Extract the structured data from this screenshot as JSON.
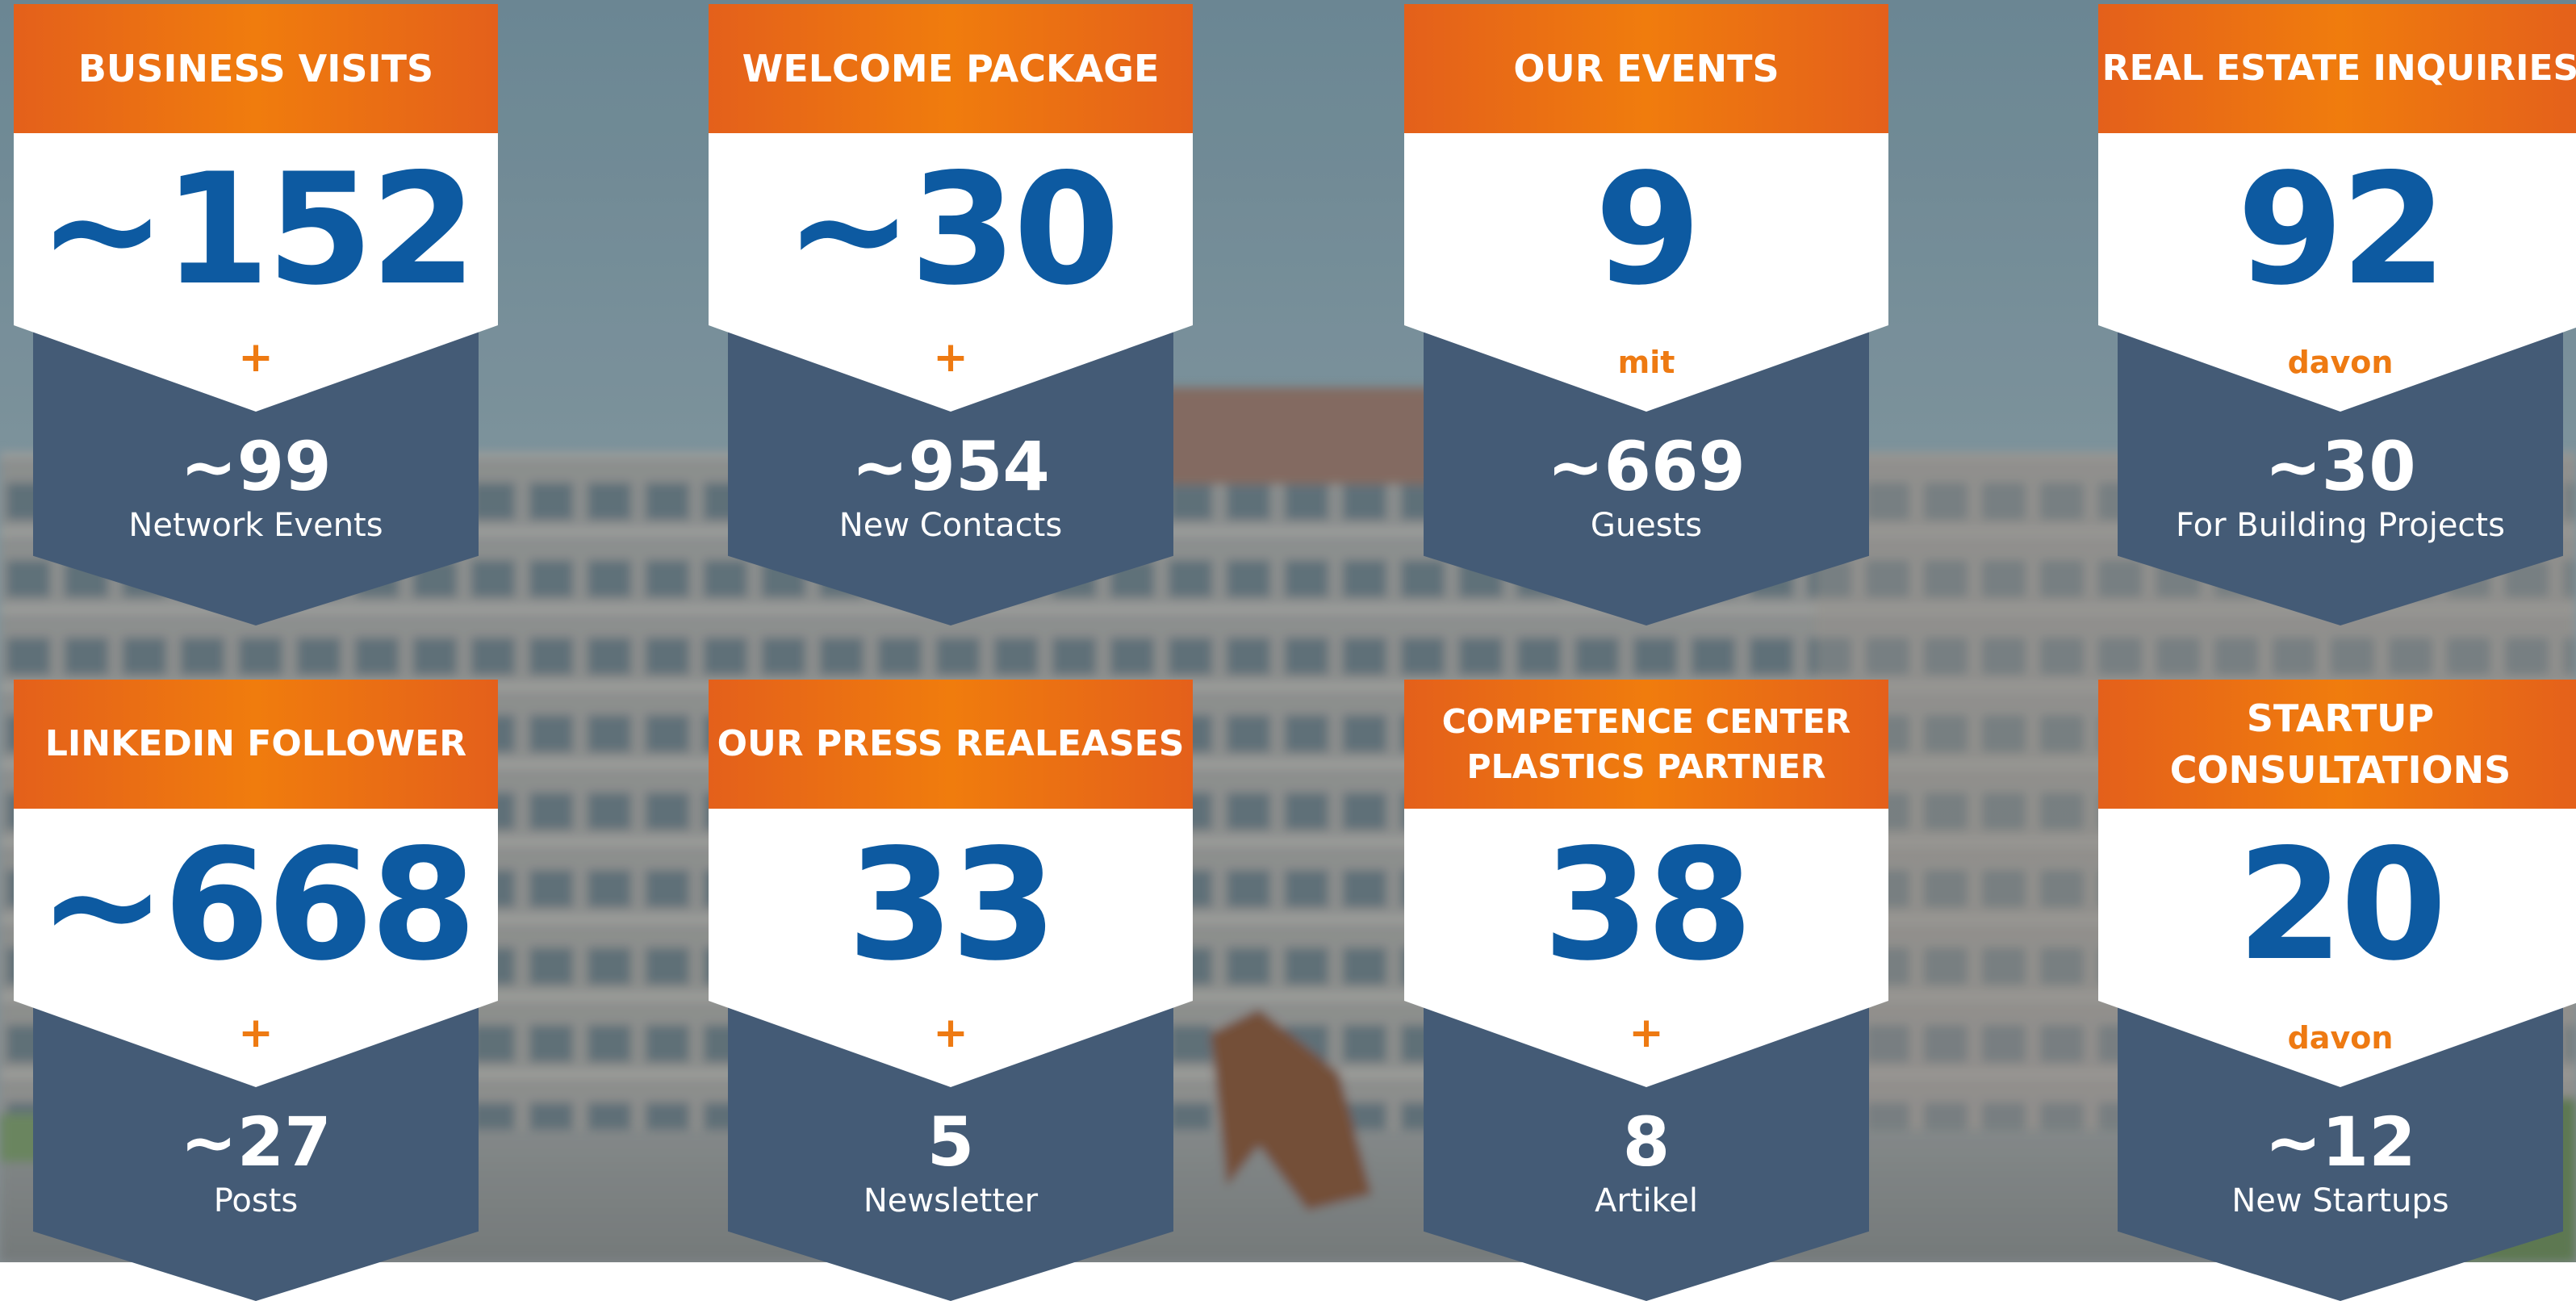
{
  "colors": {
    "header_orange": "#f07c0d",
    "number_blue": "#0d5aa1",
    "connector_orange": "#ee7a12",
    "bottom_slate": "#445b76"
  },
  "cards": [
    {
      "title": "BUSINESS VISITS",
      "main_value": "~152",
      "connector": "+",
      "sub_value": "~99",
      "sub_label": "Network Events"
    },
    {
      "title": "WELCOME PACKAGE",
      "main_value": "~30",
      "connector": "+",
      "sub_value": "~954",
      "sub_label": "New Contacts"
    },
    {
      "title": "OUR EVENTS",
      "main_value": "9",
      "connector": "mit",
      "sub_value": "~669",
      "sub_label": "Guests"
    },
    {
      "title": "REAL ESTATE INQUIRIES",
      "main_value": "92",
      "connector": "davon",
      "sub_value": "~30",
      "sub_label": "For Building Projects"
    },
    {
      "title": "LINKEDIN FOLLOWER",
      "main_value": "~668",
      "connector": "+",
      "sub_value": "~27",
      "sub_label": "Posts"
    },
    {
      "title": "OUR PRESS REALEASES",
      "main_value": "33",
      "connector": "+",
      "sub_value": "5",
      "sub_label": "Newsletter"
    },
    {
      "title": "COMPETENCE CENTER\nPLASTICS PARTNER",
      "main_value": "38",
      "connector": "+",
      "sub_value": "8",
      "sub_label": "Artikel"
    },
    {
      "title": "STARTUP\nCONSULTATIONS",
      "main_value": "20",
      "connector": "davon",
      "sub_value": "~12",
      "sub_label": "New Startups"
    }
  ]
}
